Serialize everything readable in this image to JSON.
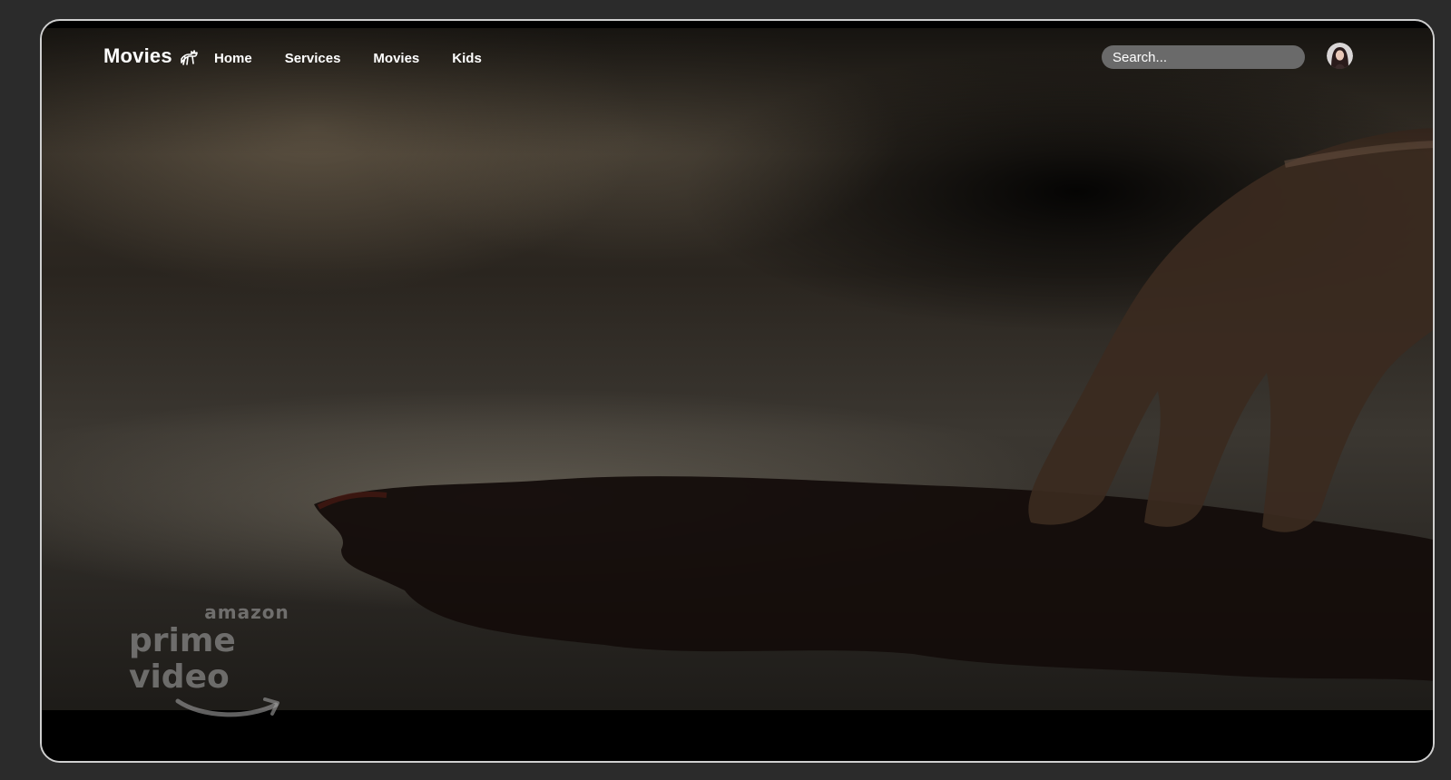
{
  "header": {
    "brand": "Movies",
    "brand_icon": "reindeer-icon",
    "nav": [
      {
        "label": "Home"
      },
      {
        "label": "Services"
      },
      {
        "label": "Movies"
      },
      {
        "label": "Kids"
      }
    ],
    "search": {
      "placeholder": "Search...",
      "value": ""
    },
    "avatar": "user-avatar"
  },
  "hero": {
    "watermark": {
      "line1": "amazon",
      "line2": "prime video"
    }
  },
  "colors": {
    "page_background": "#2b2b2b",
    "frame_border": "#cfcfcf",
    "search_background": "#6a6a6a",
    "text": "#ffffff"
  }
}
